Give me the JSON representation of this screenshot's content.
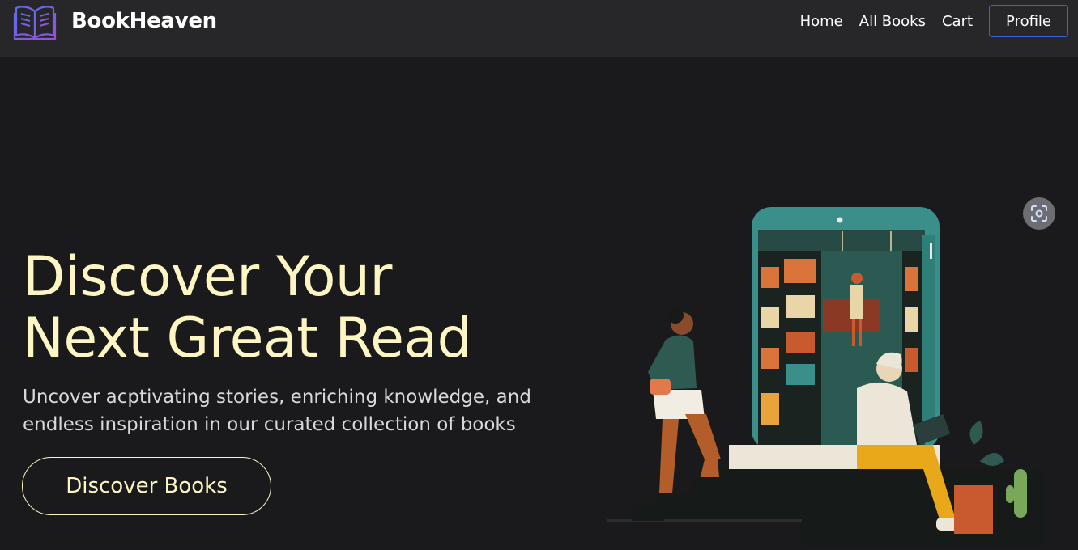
{
  "brand": {
    "name": "BookHeaven",
    "logo_icon": "open-book-icon"
  },
  "nav": {
    "home": "Home",
    "all_books": "All Books",
    "cart": "Cart",
    "profile": "Profile"
  },
  "hero": {
    "title_line1": "Discover Your",
    "title_line2": "Next Great Read",
    "subtitle_line1": "Uncover acptivating stories, enriching knowledge, and",
    "subtitle_line2": "endless inspiration in our curated collection of books",
    "cta_label": "Discover Books"
  },
  "illustration": {
    "icon": "reading-people-phone-illustration"
  },
  "overlay": {
    "icon": "visual-search-icon"
  },
  "colors": {
    "accent": "#fdf6c3",
    "navbar": "#272729",
    "background": "#1a1a1c",
    "profile_border": "#3b63d8"
  }
}
